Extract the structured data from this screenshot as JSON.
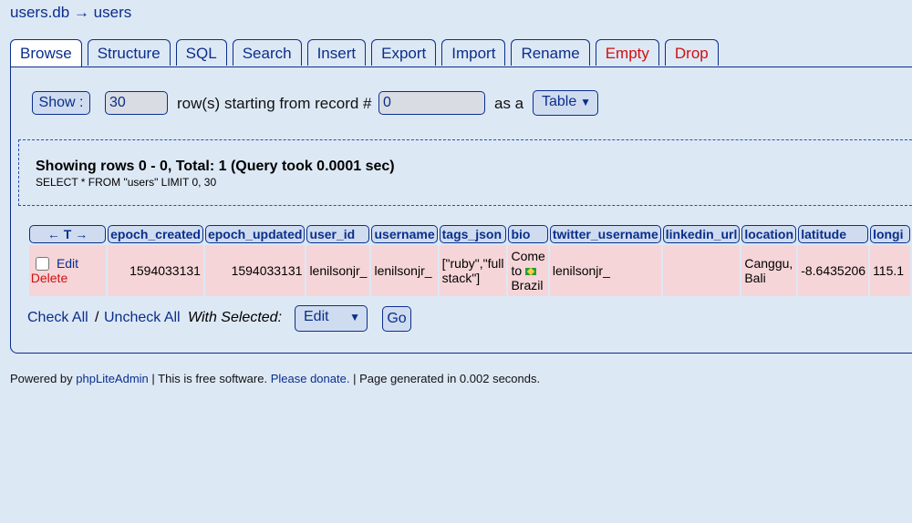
{
  "breadcrumb": {
    "db": "users.db",
    "arrow": "→",
    "table": "users"
  },
  "tabs": [
    {
      "label": "Browse"
    },
    {
      "label": "Structure"
    },
    {
      "label": "SQL"
    },
    {
      "label": "Search"
    },
    {
      "label": "Insert"
    },
    {
      "label": "Export"
    },
    {
      "label": "Import"
    },
    {
      "label": "Rename"
    },
    {
      "label": "Empty"
    },
    {
      "label": "Drop"
    }
  ],
  "controls": {
    "show_label": "Show :",
    "rows_value": "30",
    "rows_text": "row(s) starting from record #",
    "start_value": "0",
    "as_text": "as a",
    "view_select": "Table"
  },
  "result": {
    "summary": "Showing rows 0 - 0, Total: 1 (Query took 0.0001 sec)",
    "sql": "SELECT * FROM \"users\" LIMIT 0, 30"
  },
  "table": {
    "headers": [
      "← T →",
      "epoch_created",
      "epoch_updated",
      "user_id",
      "username",
      "tags_json",
      "bio",
      "twitter_username",
      "linkedin_url",
      "location",
      "latitude",
      "longi"
    ],
    "row": {
      "edit": "Edit",
      "delete": "Delete",
      "epoch_created": "1594033131",
      "epoch_updated": "1594033131",
      "user_id": "lenilsonjr_",
      "username": "lenilsonjr_",
      "tags_json": "[\"ruby\",\"full stack\"]",
      "bio_1": "Come",
      "bio_2": "to",
      "bio_3": "Brazil",
      "twitter_username": "lenilsonjr_",
      "linkedin_url": "",
      "location": "Canggu, Bali",
      "latitude": "-8.6435206",
      "longitude": "115.1"
    }
  },
  "bulk": {
    "check_all": "Check All",
    "separator": "/",
    "uncheck_all": "Uncheck All",
    "with_selected": "With Selected:",
    "action_select": "Edit",
    "go": "Go"
  },
  "footer": {
    "powered": "Powered by",
    "app_link": "phpLiteAdmin",
    "free": "| This is free software.",
    "donate": "Please donate.",
    "generated": "| Page generated in 0.002 seconds."
  },
  "colors": {
    "accent": "#0a2e8c",
    "danger": "#d01010",
    "row_bg": "#f5d5d8",
    "page_bg": "#dde8f5"
  }
}
